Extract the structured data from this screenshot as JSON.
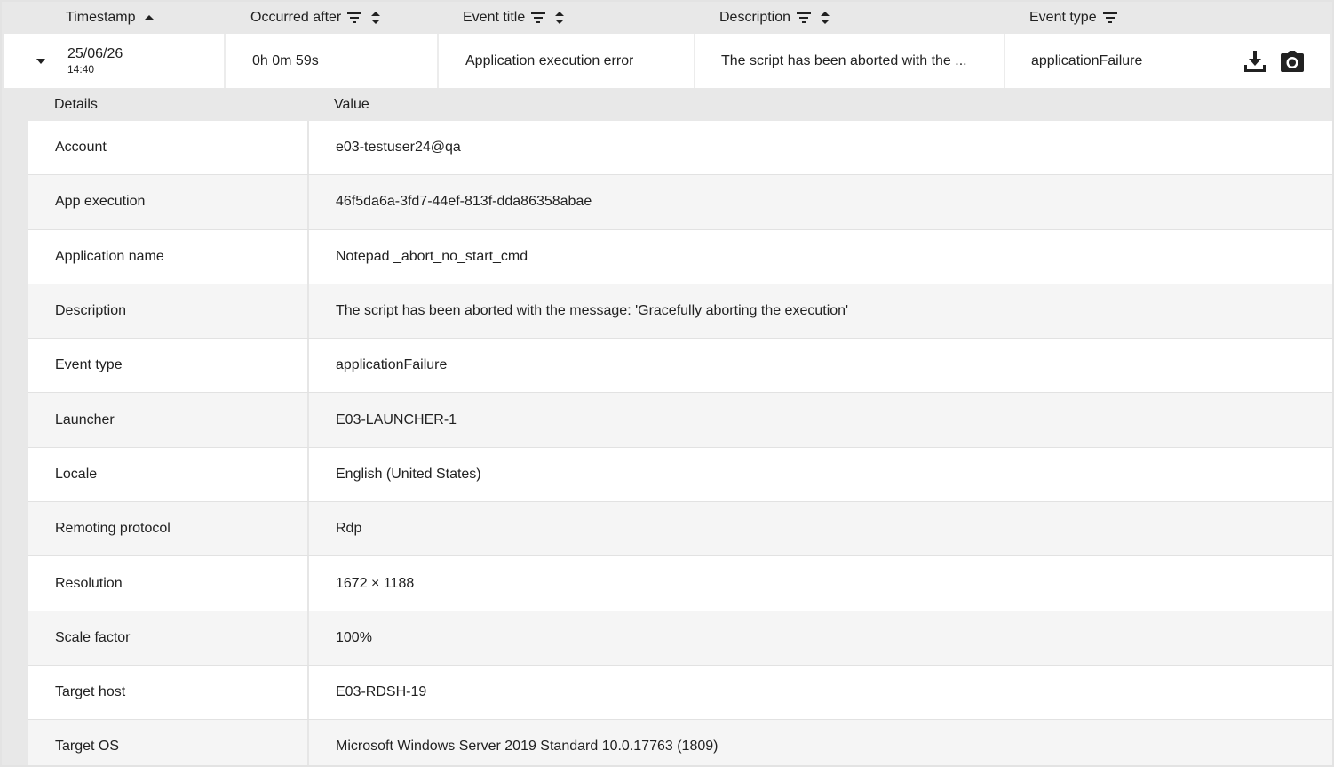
{
  "columns": {
    "timestamp": "Timestamp",
    "occurred_after": "Occurred after",
    "event_title": "Event title",
    "description": "Description",
    "event_type": "Event type"
  },
  "event": {
    "date": "25/06/26",
    "time": "14:40",
    "occurred_after": "0h 0m 59s",
    "title": "Application execution error",
    "description": "The script has been aborted with the ...",
    "event_type": "applicationFailure",
    "actions": [
      "download-icon",
      "camera-icon"
    ]
  },
  "details": {
    "header_key": "Details",
    "header_value": "Value",
    "rows": [
      {
        "key": "Account",
        "value": "e03-testuser24@qa"
      },
      {
        "key": "App execution",
        "value": "46f5da6a-3fd7-44ef-813f-dda86358abae"
      },
      {
        "key": "Application name",
        "value": "Notepad _abort_no_start_cmd"
      },
      {
        "key": "Description",
        "value": "The script has been aborted with the message: 'Gracefully aborting the execution'"
      },
      {
        "key": "Event type",
        "value": "applicationFailure"
      },
      {
        "key": "Launcher",
        "value": "E03-LAUNCHER-1"
      },
      {
        "key": "Locale",
        "value": "English (United States)"
      },
      {
        "key": "Remoting protocol",
        "value": "Rdp"
      },
      {
        "key": "Resolution",
        "value": "1672 × 1188"
      },
      {
        "key": "Scale factor",
        "value": "100%"
      },
      {
        "key": "Target host",
        "value": "E03-RDSH-19"
      },
      {
        "key": "Target OS",
        "value": "Microsoft Windows Server 2019 Standard 10.0.17763 (1809)"
      }
    ]
  }
}
